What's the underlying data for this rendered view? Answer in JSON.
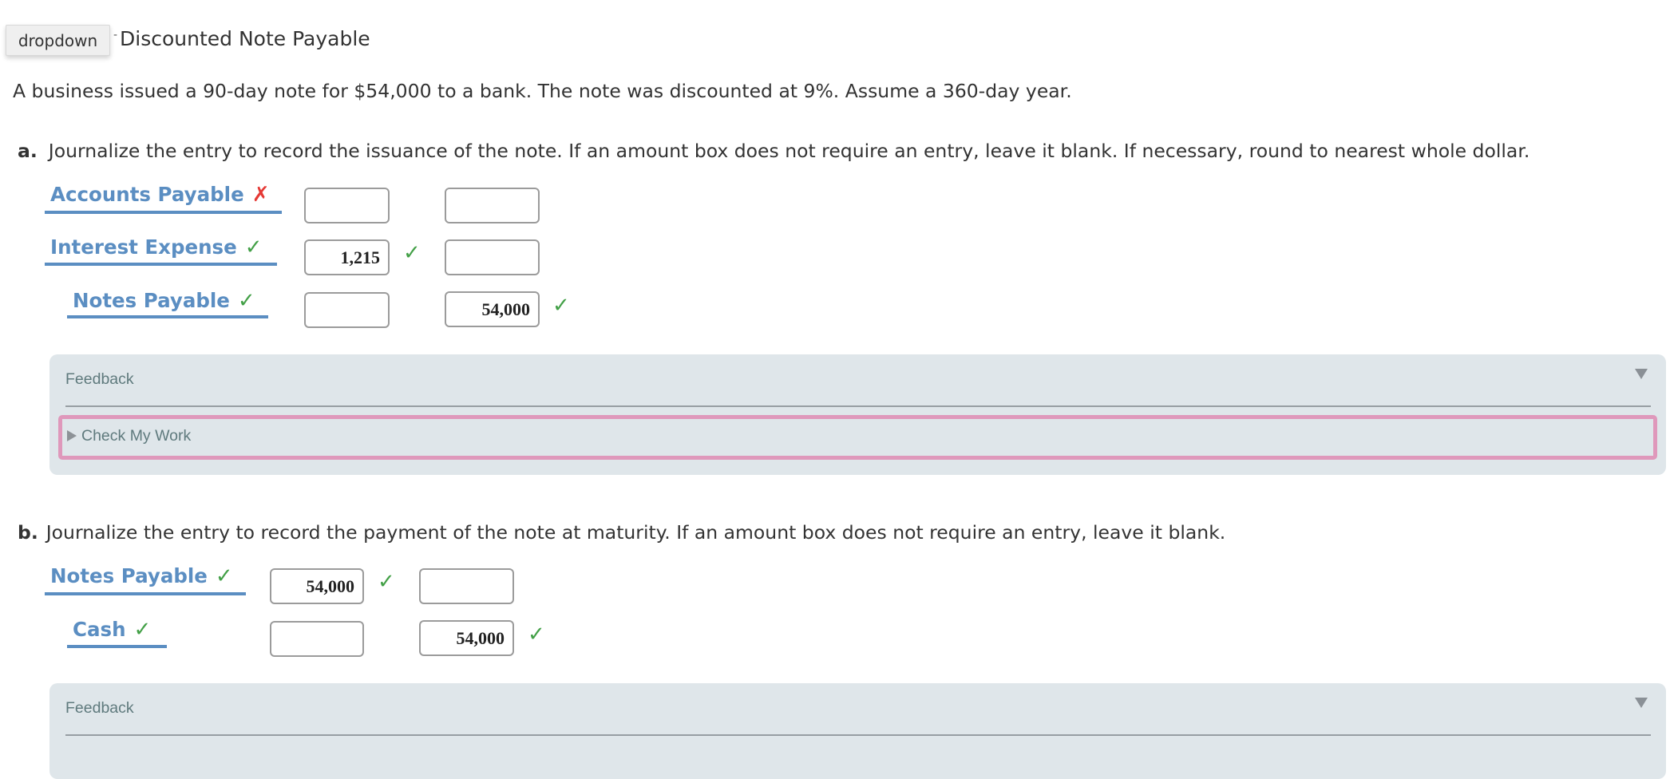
{
  "header": {
    "dropdown_label": "dropdown",
    "tick_glyph": "-",
    "title": "Discounted Note Payable"
  },
  "problem": {
    "description": "A business issued a 90-day note for $54,000 to a bank. The note was discounted at 9%. Assume a 360-day year."
  },
  "part_a": {
    "letter": "a.",
    "instruction": "Journalize the entry to record the issuance of the note. If an amount box does not require an entry, leave it blank. If necessary, round to nearest whole dollar.",
    "rows": [
      {
        "account": "Accounts Payable",
        "account_status": "incorrect",
        "account_mark": "✗",
        "debit": "",
        "credit": "",
        "debit_mark": "",
        "credit_mark": ""
      },
      {
        "account": "Interest Expense",
        "account_status": "correct",
        "account_mark": "✓",
        "debit": "1,215",
        "credit": "",
        "debit_mark": "✓",
        "credit_mark": ""
      },
      {
        "account": "Notes Payable",
        "account_status": "correct",
        "account_mark": "✓",
        "debit": "",
        "credit": "54,000",
        "debit_mark": "",
        "credit_mark": "✓"
      }
    ],
    "feedback": {
      "label": "Feedback",
      "check_my_work": "Check My Work"
    }
  },
  "part_b": {
    "letter": "b.",
    "instruction": "Journalize the entry to record the payment of the note at maturity. If an amount box does not require an entry, leave it blank.",
    "rows": [
      {
        "account": "Notes Payable",
        "account_status": "correct",
        "account_mark": "✓",
        "debit": "54,000",
        "credit": "",
        "debit_mark": "✓",
        "credit_mark": ""
      },
      {
        "account": "Cash",
        "account_status": "correct",
        "account_mark": "✓",
        "debit": "",
        "credit": "54,000",
        "debit_mark": "",
        "credit_mark": "✓"
      }
    ],
    "feedback": {
      "label": "Feedback"
    }
  },
  "colors": {
    "account_blue": "#5b8ec2",
    "correct_green": "#43a047",
    "incorrect_red": "#e53935",
    "feedback_bg": "#dfe6ea",
    "check_my_work_border": "#df98bb"
  }
}
